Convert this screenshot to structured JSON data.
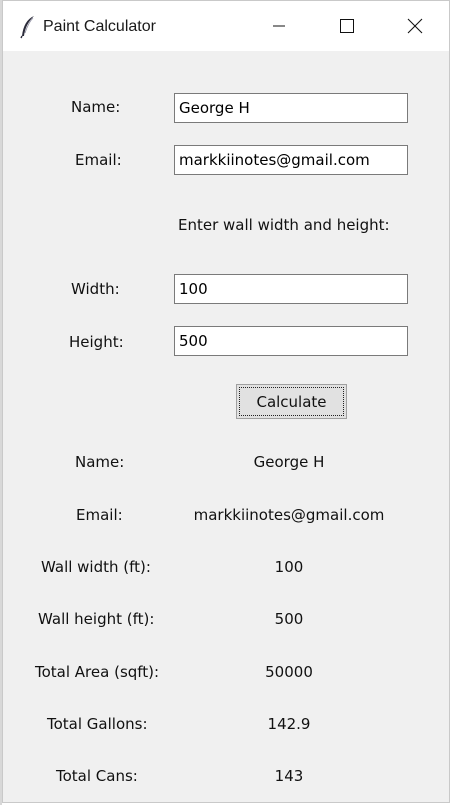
{
  "window": {
    "title": "Paint Calculator",
    "icon": "feather-icon",
    "controls": {
      "minimize": "minimize-icon",
      "maximize": "maximize-icon",
      "close": "close-icon"
    }
  },
  "form": {
    "name_label": "Name:",
    "name_value": "George H",
    "email_label": "Email:",
    "email_value": "markkiinotes@gmail.com",
    "instruction": "Enter wall width and height:",
    "width_label": "Width:",
    "width_value": "100",
    "height_label": "Height:",
    "height_value": "500",
    "calculate_label": "Calculate"
  },
  "results": [
    {
      "label": "Name:",
      "value": "George H"
    },
    {
      "label": "Email:",
      "value": "markkiinotes@gmail.com"
    },
    {
      "label": "Wall width (ft):",
      "value": "100"
    },
    {
      "label": "Wall height (ft):",
      "value": "500"
    },
    {
      "label": "Total Area (sqft):",
      "value": "50000"
    },
    {
      "label": "Total Gallons:",
      "value": "142.9"
    },
    {
      "label": "Total Cans:",
      "value": "143"
    }
  ]
}
